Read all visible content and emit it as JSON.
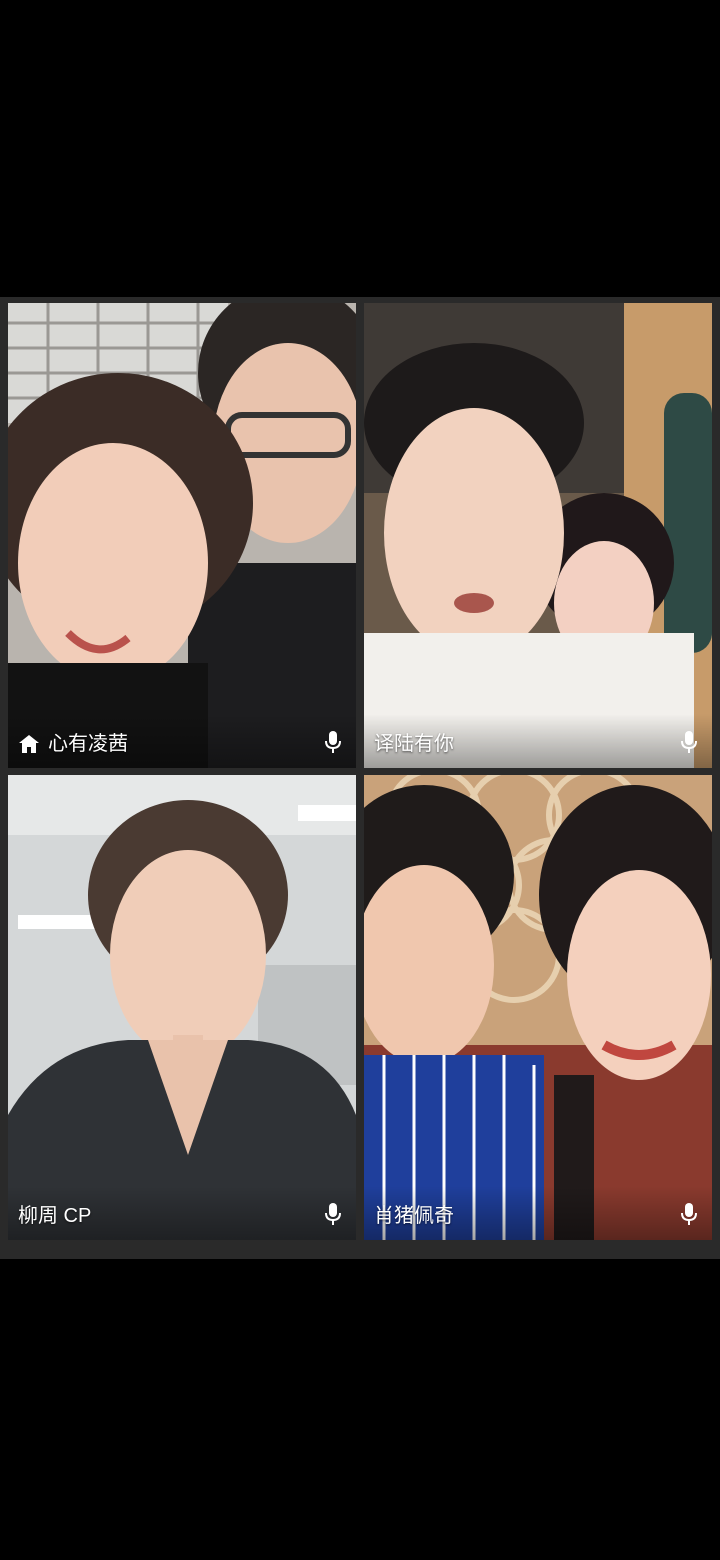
{
  "call": {
    "participants": [
      {
        "name": "心有凌茜",
        "is_host": true,
        "icon": "home-icon",
        "mic_icon": "microphone-icon"
      },
      {
        "name": "译陆有你",
        "is_host": false,
        "mic_icon": "microphone-icon"
      },
      {
        "name": "柳周 CP",
        "is_host": false,
        "mic_icon": "microphone-icon"
      },
      {
        "name": "肖猪佩奇",
        "is_host": false,
        "mic_icon": "microphone-icon"
      }
    ]
  },
  "colors": {
    "background": "#000000",
    "grid_gap": "#2a2a2a",
    "label_text": "#ffffff"
  }
}
